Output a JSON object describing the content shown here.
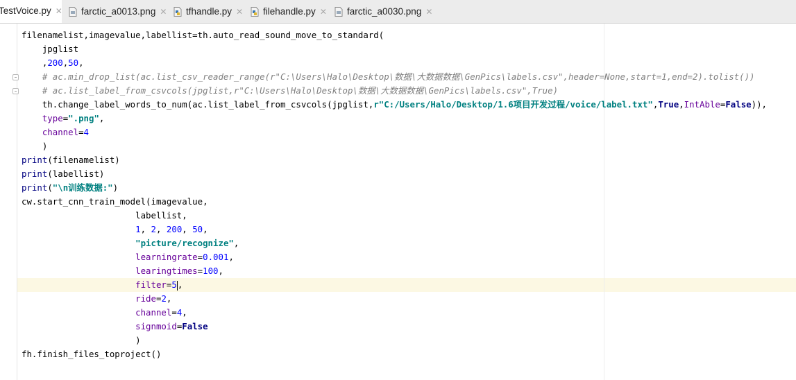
{
  "tabs": [
    {
      "label": "TestVoice.py",
      "active": true,
      "icon": "python-file-icon"
    },
    {
      "label": "farctic_a0013.png",
      "active": false,
      "icon": "image-file-icon"
    },
    {
      "label": "tfhandle.py",
      "active": false,
      "icon": "python-file-icon"
    },
    {
      "label": "filehandle.py",
      "active": false,
      "icon": "python-file-icon"
    },
    {
      "label": "farctic_a0030.png",
      "active": false,
      "icon": "image-file-icon"
    }
  ],
  "close_glyph": "✕",
  "code": {
    "l1": {
      "a": "filenamelist,imagevalue,labellist=th.auto_read_sound_move_to_standard("
    },
    "l2": {
      "a": "    jpglist"
    },
    "l3": {
      "a": "    ,",
      "n1": "200",
      "b": ",",
      "n2": "50",
      "c": ","
    },
    "l4": {
      "a": "    ",
      "cmt": "# ac.min_drop_list(ac.list_csv_reader_range(r\"C:\\Users\\Halo\\Desktop\\数据\\大数据数据\\GenPics\\labels.csv\",header=None,start=1,end=2).tolist())"
    },
    "l5": {
      "a": "    ",
      "cmt": "# ac.list_label_from_csvcols(jpglist,r\"C:\\Users\\Halo\\Desktop\\数据\\大数据数据\\GenPics\\labels.csv\",True)"
    },
    "l6": {
      "a": "    th.change_label_words_to_num(ac.list_label_from_csvcols(jpglist,",
      "str": "r\"C:/Users/Halo/Desktop/1.6项目开发过程/voice/label.txt\"",
      "b": ",",
      "kw1": "True",
      "c": ",",
      "p": "IntAble",
      "d": "=",
      "kw2": "False",
      "e": ")),"
    },
    "l7": {
      "a": "    ",
      "p": "type",
      "b": "=",
      "str": "\".png\"",
      "c": ","
    },
    "l8": {
      "a": "    ",
      "p": "channel",
      "b": "=",
      "n": "4"
    },
    "l9": {
      "a": "    )"
    },
    "l10": {
      "f": "print",
      "a": "(filenamelist)"
    },
    "l11": {
      "f": "print",
      "a": "(labellist)"
    },
    "l12": {
      "f": "print",
      "a": "(",
      "str": "\"\\n训练数据:\"",
      "b": ")"
    },
    "l13": {
      "a": "cw.start_cnn_train_model(imagevalue,"
    },
    "l14": {
      "a": "                      labellist,"
    },
    "l15": {
      "a": "                      ",
      "n1": "1",
      "b": ", ",
      "n2": "2",
      "c": ", ",
      "n3": "200",
      "d": ", ",
      "n4": "50",
      "e": ","
    },
    "l16": {
      "a": "                      ",
      "str": "\"picture/recognize\"",
      "b": ","
    },
    "l17": {
      "a": "                      ",
      "p": "learningrate",
      "b": "=",
      "n": "0.001",
      "c": ","
    },
    "l18": {
      "a": "                      ",
      "p": "learingtimes",
      "b": "=",
      "n": "100",
      "c": ","
    },
    "l19": {
      "a": "                      ",
      "p": "filter",
      "b": "=",
      "n": "5",
      "c": ","
    },
    "l20": {
      "a": "                      ",
      "p": "ride",
      "b": "=",
      "n": "2",
      "c": ","
    },
    "l21": {
      "a": "                      ",
      "p": "channel",
      "b": "=",
      "n": "4",
      "c": ","
    },
    "l22": {
      "a": "                      ",
      "p": "signmoid",
      "b": "=",
      "kw": "False"
    },
    "l23": {
      "a": "                      )"
    },
    "l24": {
      "a": "fh.finish_files_toproject()"
    }
  },
  "colors": {
    "keyword": "#000080",
    "number": "#0000ff",
    "string": "#008080",
    "comment": "#808080",
    "param": "#660099",
    "caret_line": "#fcf8e3"
  }
}
